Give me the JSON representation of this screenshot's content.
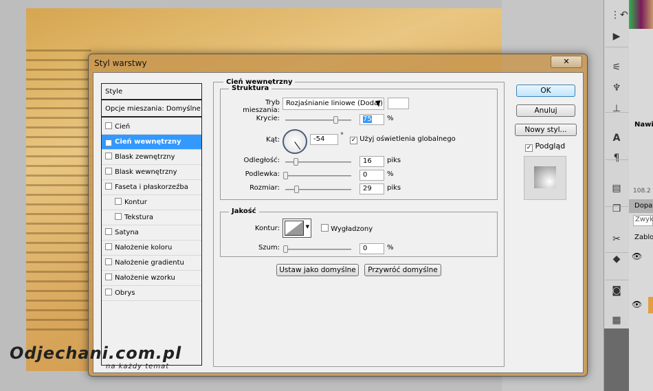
{
  "dialog": {
    "title": "Styl warstwy",
    "close": "✕"
  },
  "styles_list": {
    "header": "Style",
    "blending": "Opcje mieszania: Domyślne",
    "items": [
      {
        "label": "Cień",
        "checked": false
      },
      {
        "label": "Cień wewnętrzny",
        "checked": true,
        "selected": true
      },
      {
        "label": "Blask zewnętrzny",
        "checked": false
      },
      {
        "label": "Blask wewnętrzny",
        "checked": false
      },
      {
        "label": "Faseta i płaskorzeźba",
        "checked": false
      },
      {
        "label": "Kontur",
        "checked": false
      },
      {
        "label": "Tekstura",
        "checked": false
      },
      {
        "label": "Satyna",
        "checked": false
      },
      {
        "label": "Nałożenie koloru",
        "checked": false
      },
      {
        "label": "Nałożenie gradientu",
        "checked": false
      },
      {
        "label": "Nałożenie wzorku",
        "checked": false
      },
      {
        "label": "Obrys",
        "checked": false
      }
    ]
  },
  "panel": {
    "title": "Cień wewnętrzny",
    "structure": {
      "title": "Struktura",
      "blend_label": "Tryb mieszania:",
      "blend_value": "Rozjaśnianie liniowe (Dodaj)",
      "color": "#ffffff",
      "opacity_label": "Krycie:",
      "opacity": "75",
      "opacity_unit": "%",
      "angle_label": "Kąt:",
      "angle": "-54",
      "angle_unit": "°",
      "global_light": "Użyj oświetlenia globalnego",
      "global_light_checked": true,
      "distance_label": "Odległość:",
      "distance": "16",
      "distance_unit": "piks",
      "choke_label": "Podlewka:",
      "choke": "0",
      "choke_unit": "%",
      "size_label": "Rozmiar:",
      "size": "29",
      "size_unit": "piks"
    },
    "quality": {
      "title": "Jakość",
      "contour_label": "Kontur:",
      "antialias": "Wygładzony",
      "antialias_checked": false,
      "noise_label": "Szum:",
      "noise": "0",
      "noise_unit": "%"
    },
    "make_default": "Ustaw jako domyślne",
    "reset_default": "Przywróć domyślne"
  },
  "buttons": {
    "ok": "OK",
    "cancel": "Anuluj",
    "new_style": "Nowy styl...",
    "preview": "Podgląd",
    "preview_checked": true
  },
  "side_panels": {
    "navigator": "Nawig",
    "zoom": "108.2",
    "adjust": "Dopas",
    "blend": "Zwyk",
    "lock": "Zablo"
  },
  "watermark": {
    "text": "Odjechani.com.pl",
    "tagline": "na każdy temat"
  }
}
